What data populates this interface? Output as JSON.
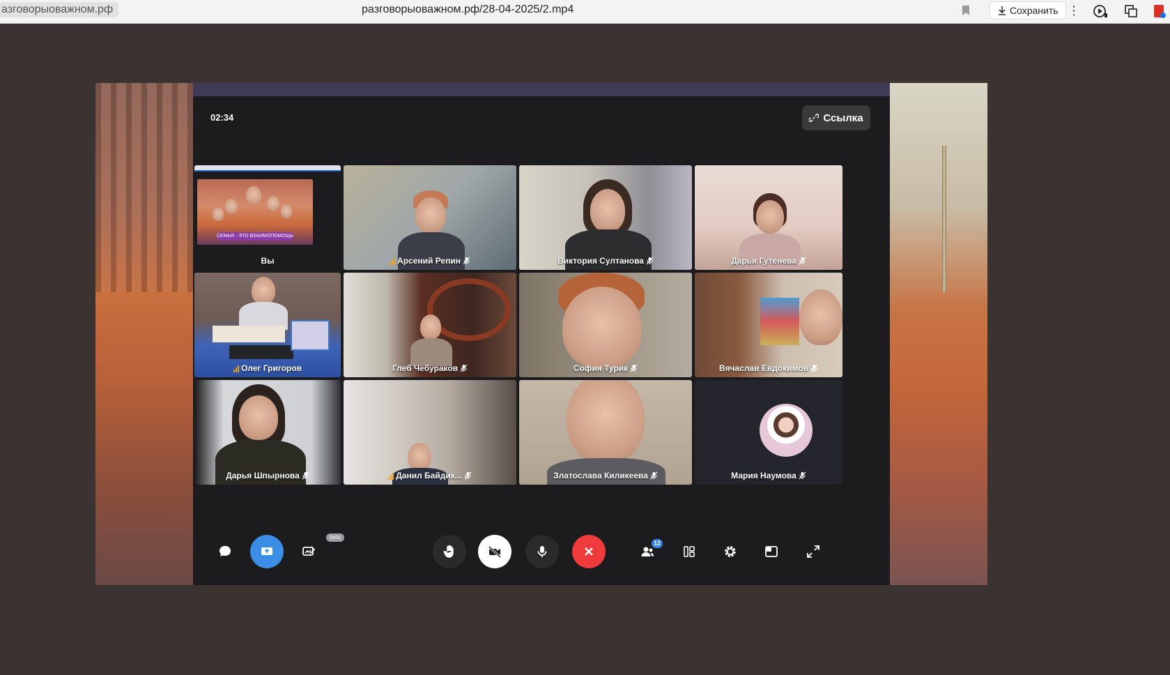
{
  "browser": {
    "tab_domain": "азговорыоважном.рф",
    "url": "разговорыоважном.рф/28-04-2025/2.mp4",
    "save_label": "Сохранить"
  },
  "call": {
    "timer": "02:34",
    "link_label": "Ссылка",
    "beta_label": "beta",
    "participants_count": "12",
    "self_slide_caption": "СЕМЬЯ - ЭТО ВЗАИМОПОМОЩЬ",
    "tiles": [
      {
        "name": "Вы"
      },
      {
        "name": "Арсений Репин"
      },
      {
        "name": "Виктория Султанова"
      },
      {
        "name": "Дарья Гутенева"
      },
      {
        "name": "Олег Григоров"
      },
      {
        "name": "Глеб Чебураков"
      },
      {
        "name": "София Турик"
      },
      {
        "name": "Вячаслав Евдокимов"
      },
      {
        "name": "Дарья Шпырнова"
      },
      {
        "name": "Данил Байдик..."
      },
      {
        "name": "Златослава Киликеева"
      },
      {
        "name": "Мария Наумова"
      }
    ]
  },
  "icons": {
    "chat": "chat-bubble-icon",
    "share": "share-screen-icon",
    "whiteboard": "whiteboard-icon",
    "hand": "raise-hand-icon",
    "camera": "camera-off-icon",
    "mic": "microphone-icon",
    "end": "end-call-icon",
    "participants": "participants-icon",
    "layout": "layout-icon",
    "settings": "gear-icon",
    "pip": "picture-in-picture-icon",
    "fullscreen": "fullscreen-icon"
  },
  "colors": {
    "call_bg": "#1c1c1e",
    "end_call": "#ef3b3b",
    "share_active": "#3a8ee6",
    "speaking_signal": "#f0a020"
  }
}
